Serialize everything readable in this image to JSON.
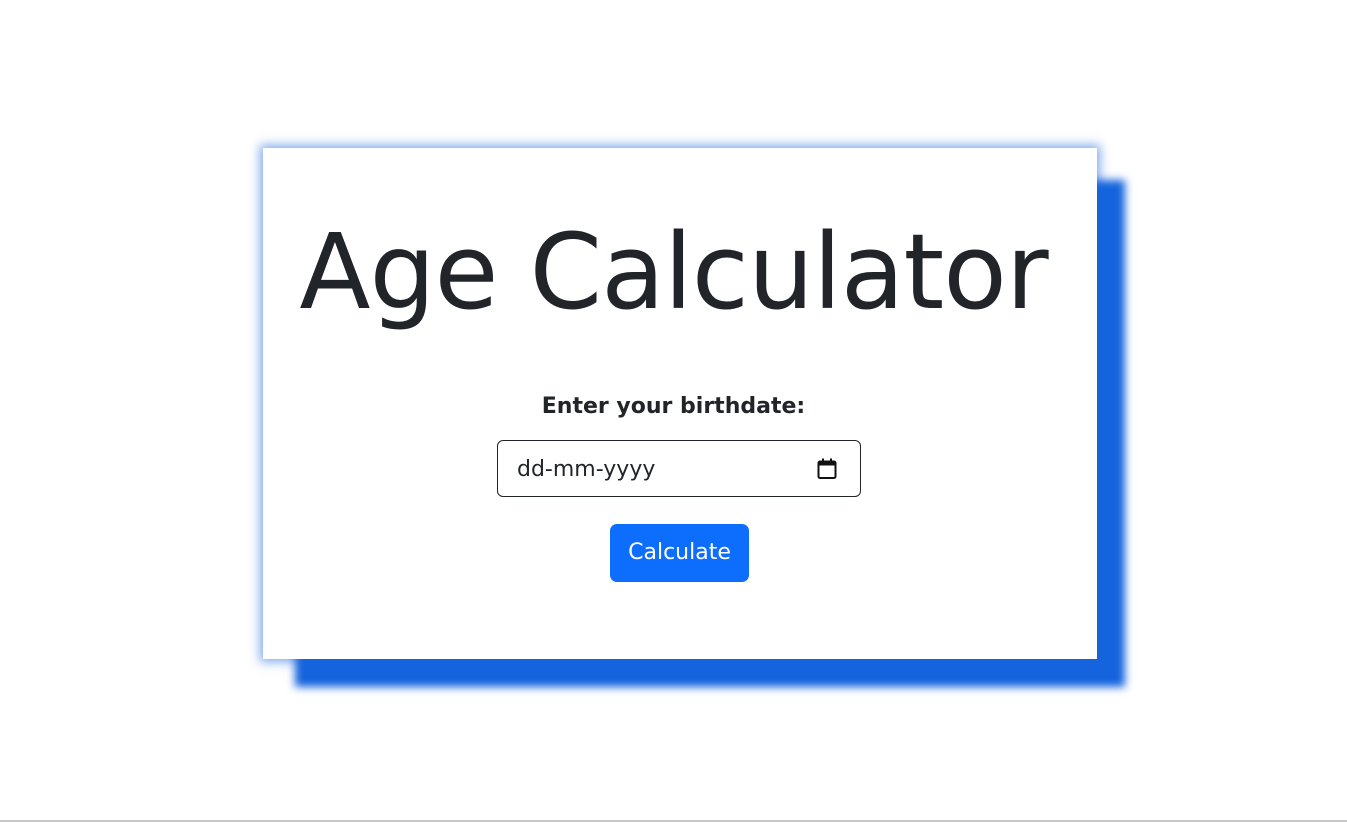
{
  "page": {
    "title": "Age Calculator",
    "form": {
      "label": "Enter your birthdate:",
      "date_placeholder": "dd-mm-yyyy",
      "calculate_label": "Calculate"
    }
  },
  "icons": {
    "date_picker": "calendar-icon"
  },
  "colors": {
    "accent": "#0d6efd",
    "card_shadow": "#1564de",
    "text": "#212529",
    "background": "#ffffff"
  }
}
